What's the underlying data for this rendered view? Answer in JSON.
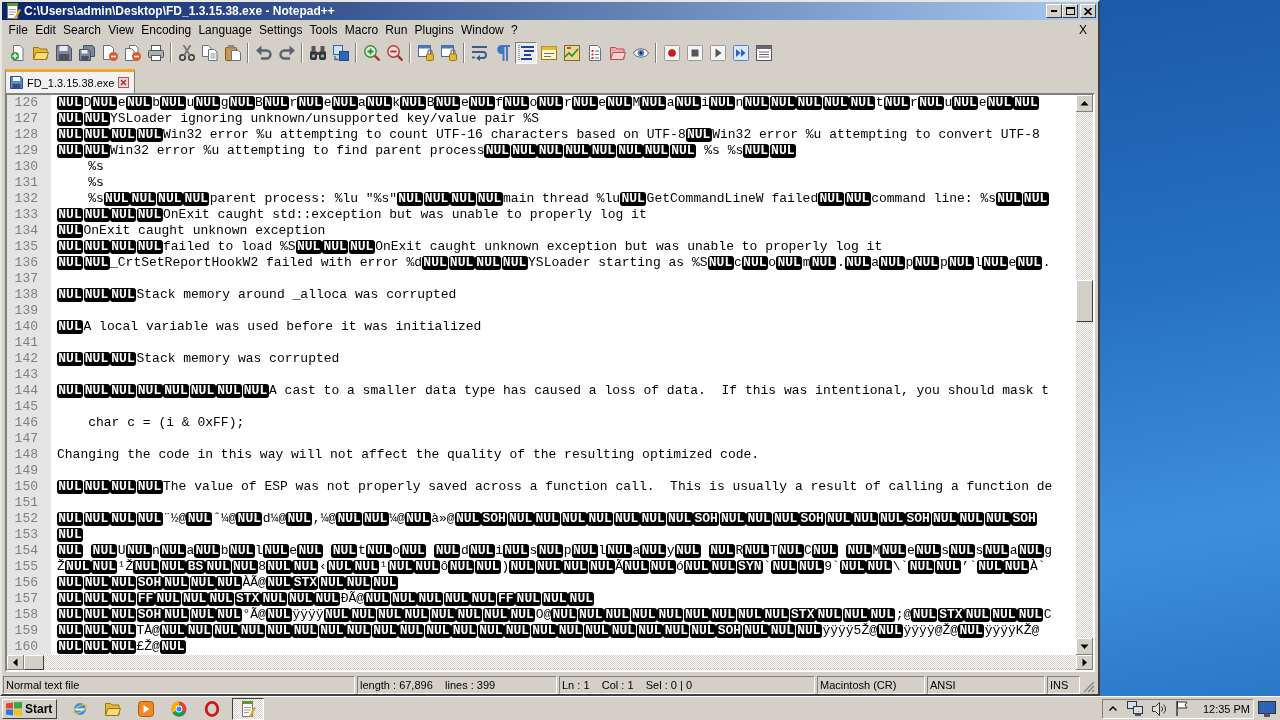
{
  "window": {
    "title": "C:\\Users\\admin\\Desktop\\FD_1.3.15.38.exe - Notepad++"
  },
  "menu": {
    "items": [
      "File",
      "Edit",
      "Search",
      "View",
      "Encoding",
      "Language",
      "Settings",
      "Tools",
      "Macro",
      "Run",
      "Plugins",
      "Window",
      "?"
    ],
    "close": "X"
  },
  "toolbar": [
    [
      {
        "pressed": false
      },
      {
        "pressed": false
      },
      {
        "pressed": false
      },
      {
        "pressed": false
      },
      {
        "pressed": false
      },
      {
        "pressed": false
      },
      {
        "pressed": false
      }
    ],
    [
      {
        "pressed": false
      },
      {
        "pressed": false
      },
      {
        "pressed": false
      }
    ],
    [
      {
        "pressed": false
      },
      {
        "pressed": false
      }
    ],
    [
      {
        "pressed": false
      },
      {
        "pressed": false
      }
    ],
    [
      {
        "pressed": false
      },
      {
        "pressed": false
      }
    ],
    [
      {
        "pressed": false
      },
      {
        "pressed": false
      }
    ],
    [
      {
        "pressed": false
      },
      {
        "pressed": false
      },
      {
        "pressed": true
      },
      {
        "pressed": false
      },
      {
        "pressed": false
      },
      {
        "pressed": false
      },
      {
        "pressed": false
      },
      {
        "pressed": false
      }
    ],
    [
      {
        "pressed": false
      },
      {
        "pressed": false
      },
      {
        "pressed": false
      },
      {
        "pressed": false
      },
      {
        "pressed": false
      }
    ]
  ],
  "tabs": [
    {
      "label": "FD_1.3.15.38.exe",
      "selected": true
    }
  ],
  "editor": {
    "lines": [
      {
        "number": "126",
        "segments": [
          {
            "kind": "ctrl",
            "text": "NUL"
          },
          {
            "kind": "text",
            "text": "D"
          },
          {
            "kind": "ctrl",
            "text": "NUL"
          },
          {
            "kind": "text",
            "text": "e"
          },
          {
            "kind": "ctrl",
            "text": "NUL"
          },
          {
            "kind": "text",
            "text": "b"
          },
          {
            "kind": "ctrl",
            "text": "NUL"
          },
          {
            "kind": "text",
            "text": "u"
          },
          {
            "kind": "ctrl",
            "text": "NUL"
          },
          {
            "kind": "text",
            "text": "g"
          },
          {
            "kind": "ctrl",
            "text": "NUL"
          },
          {
            "kind": "text",
            "text": "B"
          },
          {
            "kind": "ctrl",
            "text": "NUL"
          },
          {
            "kind": "text",
            "text": "r"
          },
          {
            "kind": "ctrl",
            "text": "NUL"
          },
          {
            "kind": "text",
            "text": "e"
          },
          {
            "kind": "ctrl",
            "text": "NUL"
          },
          {
            "kind": "text",
            "text": "a"
          },
          {
            "kind": "ctrl",
            "text": "NUL"
          },
          {
            "kind": "text",
            "text": "k"
          },
          {
            "kind": "ctrl",
            "text": "NUL"
          },
          {
            "kind": "text",
            "text": "B"
          },
          {
            "kind": "ctrl",
            "text": "NUL"
          },
          {
            "kind": "text",
            "text": "e"
          },
          {
            "kind": "ctrl",
            "text": "NUL"
          },
          {
            "kind": "text",
            "text": "f"
          },
          {
            "kind": "ctrl",
            "text": "NUL"
          },
          {
            "kind": "text",
            "text": "o"
          },
          {
            "kind": "ctrl",
            "text": "NUL"
          },
          {
            "kind": "text",
            "text": "r"
          },
          {
            "kind": "ctrl",
            "text": "NUL"
          },
          {
            "kind": "text",
            "text": "e"
          },
          {
            "kind": "ctrl",
            "text": "NUL"
          },
          {
            "kind": "text",
            "text": "M"
          },
          {
            "kind": "ctrl",
            "text": "NUL"
          },
          {
            "kind": "text",
            "text": "a"
          },
          {
            "kind": "ctrl",
            "text": "NUL"
          },
          {
            "kind": "text",
            "text": "i"
          },
          {
            "kind": "ctrl",
            "text": "NUL"
          },
          {
            "kind": "text",
            "text": "n"
          },
          {
            "kind": "ctrl",
            "text": "NUL"
          },
          {
            "kind": "ctrl",
            "text": "NUL"
          },
          {
            "kind": "ctrl",
            "text": "NUL"
          },
          {
            "kind": "ctrl",
            "text": "NUL"
          },
          {
            "kind": "ctrl",
            "text": "NUL"
          },
          {
            "kind": "text",
            "text": "t"
          },
          {
            "kind": "ctrl",
            "text": "NUL"
          },
          {
            "kind": "text",
            "text": "r"
          },
          {
            "kind": "ctrl",
            "text": "NUL"
          },
          {
            "kind": "text",
            "text": "u"
          },
          {
            "kind": "ctrl",
            "text": "NUL"
          },
          {
            "kind": "text",
            "text": "e"
          },
          {
            "kind": "ctrl",
            "text": "NUL"
          },
          {
            "kind": "ctrl",
            "text": "NUL"
          }
        ]
      },
      {
        "number": "127",
        "segments": [
          {
            "kind": "ctrl",
            "text": "NUL"
          },
          {
            "kind": "ctrl",
            "text": "NUL"
          },
          {
            "kind": "text",
            "text": "YSLoader ignoring unknown/unsupported key/value pair %S"
          }
        ]
      },
      {
        "number": "128",
        "segments": [
          {
            "kind": "ctrl",
            "text": "NUL"
          },
          {
            "kind": "ctrl",
            "text": "NUL"
          },
          {
            "kind": "ctrl",
            "text": "NUL"
          },
          {
            "kind": "ctrl",
            "text": "NUL"
          },
          {
            "kind": "text",
            "text": "Win32 error %u attempting to count UTF-16 characters based on UTF-8"
          },
          {
            "kind": "ctrl",
            "text": "NUL"
          },
          {
            "kind": "text",
            "text": "Win32 error %u attempting to convert UTF-8"
          }
        ]
      },
      {
        "number": "129",
        "segments": [
          {
            "kind": "ctrl",
            "text": "NUL"
          },
          {
            "kind": "ctrl",
            "text": "NUL"
          },
          {
            "kind": "text",
            "text": "Win32 error %u attempting to find parent process"
          },
          {
            "kind": "ctrl",
            "text": "NUL"
          },
          {
            "kind": "ctrl",
            "text": "NUL"
          },
          {
            "kind": "ctrl",
            "text": "NUL"
          },
          {
            "kind": "ctrl",
            "text": "NUL"
          },
          {
            "kind": "ctrl",
            "text": "NUL"
          },
          {
            "kind": "ctrl",
            "text": "NUL"
          },
          {
            "kind": "ctrl",
            "text": "NUL"
          },
          {
            "kind": "ctrl",
            "text": "NUL"
          },
          {
            "kind": "space"
          },
          {
            "kind": "text",
            "text": "%s %s"
          },
          {
            "kind": "ctrl",
            "text": "NUL"
          },
          {
            "kind": "ctrl",
            "text": "NUL"
          }
        ]
      },
      {
        "number": "130",
        "segments": [
          {
            "kind": "indent"
          },
          {
            "kind": "text",
            "text": "%s"
          }
        ]
      },
      {
        "number": "131",
        "segments": [
          {
            "kind": "indent"
          },
          {
            "kind": "text",
            "text": "%s"
          }
        ]
      },
      {
        "number": "132",
        "segments": [
          {
            "kind": "indent"
          },
          {
            "kind": "text",
            "text": "%s"
          },
          {
            "kind": "ctrl",
            "text": "NUL"
          },
          {
            "kind": "ctrl",
            "text": "NUL"
          },
          {
            "kind": "ctrl",
            "text": "NUL"
          },
          {
            "kind": "ctrl",
            "text": "NUL"
          },
          {
            "kind": "text",
            "text": "parent process: %lu \"%s\""
          },
          {
            "kind": "ctrl",
            "text": "NUL"
          },
          {
            "kind": "ctrl",
            "text": "NUL"
          },
          {
            "kind": "ctrl",
            "text": "NUL"
          },
          {
            "kind": "ctrl",
            "text": "NUL"
          },
          {
            "kind": "text",
            "text": "main thread %lu"
          },
          {
            "kind": "ctrl",
            "text": "NUL"
          },
          {
            "kind": "text",
            "text": "GetCommandLineW failed"
          },
          {
            "kind": "ctrl",
            "text": "NUL"
          },
          {
            "kind": "ctrl",
            "text": "NUL"
          },
          {
            "kind": "text",
            "text": "command line: %s"
          },
          {
            "kind": "ctrl",
            "text": "NUL"
          },
          {
            "kind": "ctrl",
            "text": "NUL"
          }
        ]
      },
      {
        "number": "133",
        "segments": [
          {
            "kind": "ctrl",
            "text": "NUL"
          },
          {
            "kind": "ctrl",
            "text": "NUL"
          },
          {
            "kind": "ctrl",
            "text": "NUL"
          },
          {
            "kind": "ctrl",
            "text": "NUL"
          },
          {
            "kind": "text",
            "text": "OnExit caught std::exception but was unable to properly log it"
          }
        ]
      },
      {
        "number": "134",
        "segments": [
          {
            "kind": "ctrl",
            "text": "NUL"
          },
          {
            "kind": "text",
            "text": "OnExit caught unknown exception"
          }
        ]
      },
      {
        "number": "135",
        "segments": [
          {
            "kind": "ctrl",
            "text": "NUL"
          },
          {
            "kind": "ctrl",
            "text": "NUL"
          },
          {
            "kind": "ctrl",
            "text": "NUL"
          },
          {
            "kind": "ctrl",
            "text": "NUL"
          },
          {
            "kind": "text",
            "text": "failed to load %S"
          },
          {
            "kind": "ctrl",
            "text": "NUL"
          },
          {
            "kind": "ctrl",
            "text": "NUL"
          },
          {
            "kind": "ctrl",
            "text": "NUL"
          },
          {
            "kind": "text",
            "text": "OnExit caught unknown exception but was unable to properly log it"
          }
        ]
      },
      {
        "number": "136",
        "segments": [
          {
            "kind": "ctrl",
            "text": "NUL"
          },
          {
            "kind": "ctrl",
            "text": "NUL"
          },
          {
            "kind": "text",
            "text": "_CrtSetReportHookW2 failed with error %d"
          },
          {
            "kind": "ctrl",
            "text": "NUL"
          },
          {
            "kind": "ctrl",
            "text": "NUL"
          },
          {
            "kind": "ctrl",
            "text": "NUL"
          },
          {
            "kind": "ctrl",
            "text": "NUL"
          },
          {
            "kind": "text",
            "text": "YSLoader starting as %S"
          },
          {
            "kind": "ctrl",
            "text": "NUL"
          },
          {
            "kind": "text",
            "text": "c"
          },
          {
            "kind": "ctrl",
            "text": "NUL"
          },
          {
            "kind": "text",
            "text": "o"
          },
          {
            "kind": "ctrl",
            "text": "NUL"
          },
          {
            "kind": "text",
            "text": "m"
          },
          {
            "kind": "ctrl",
            "text": "NUL"
          },
          {
            "kind": "text",
            "text": "."
          },
          {
            "kind": "ctrl",
            "text": "NUL"
          },
          {
            "kind": "text",
            "text": "a"
          },
          {
            "kind": "ctrl",
            "text": "NUL"
          },
          {
            "kind": "text",
            "text": "p"
          },
          {
            "kind": "ctrl",
            "text": "NUL"
          },
          {
            "kind": "text",
            "text": "p"
          },
          {
            "kind": "ctrl",
            "text": "NUL"
          },
          {
            "kind": "text",
            "text": "l"
          },
          {
            "kind": "ctrl",
            "text": "NUL"
          },
          {
            "kind": "text",
            "text": "e"
          },
          {
            "kind": "ctrl",
            "text": "NUL"
          },
          {
            "kind": "text",
            "text": "."
          }
        ]
      },
      {
        "number": "137"
      },
      {
        "number": "138",
        "segments": [
          {
            "kind": "ctrl",
            "text": "NUL"
          },
          {
            "kind": "ctrl",
            "text": "NUL"
          },
          {
            "kind": "ctrl",
            "text": "NUL"
          },
          {
            "kind": "text",
            "text": "Stack memory around _alloca was corrupted"
          }
        ]
      },
      {
        "number": "139"
      },
      {
        "number": "140",
        "segments": [
          {
            "kind": "ctrl",
            "text": "NUL"
          },
          {
            "kind": "text",
            "text": "A local variable was used before it was initialized"
          }
        ]
      },
      {
        "number": "141"
      },
      {
        "number": "142",
        "segments": [
          {
            "kind": "ctrl",
            "text": "NUL"
          },
          {
            "kind": "ctrl",
            "text": "NUL"
          },
          {
            "kind": "ctrl",
            "text": "NUL"
          },
          {
            "kind": "text",
            "text": "Stack memory was corrupted"
          }
        ]
      },
      {
        "number": "143"
      },
      {
        "number": "144",
        "segments": [
          {
            "kind": "ctrl",
            "text": "NUL"
          },
          {
            "kind": "ctrl",
            "text": "NUL"
          },
          {
            "kind": "ctrl",
            "text": "NUL"
          },
          {
            "kind": "ctrl",
            "text": "NUL"
          },
          {
            "kind": "ctrl",
            "text": "NUL"
          },
          {
            "kind": "ctrl",
            "text": "NUL"
          },
          {
            "kind": "ctrl",
            "text": "NUL"
          },
          {
            "kind": "ctrl",
            "text": "NUL"
          },
          {
            "kind": "text",
            "text": "A cast to a smaller data type has caused a loss of data.  If this was intentional, you should mask t"
          }
        ]
      },
      {
        "number": "145"
      },
      {
        "number": "146",
        "segments": [
          {
            "kind": "indent"
          },
          {
            "kind": "text",
            "text": "char c = (i & 0xFF);"
          }
        ]
      },
      {
        "number": "147"
      },
      {
        "number": "148",
        "segments": [
          {
            "kind": "text",
            "text": "Changing the code in this way will not affect the quality of the resulting optimized code."
          }
        ]
      },
      {
        "number": "149"
      },
      {
        "number": "150",
        "segments": [
          {
            "kind": "ctrl",
            "text": "NUL"
          },
          {
            "kind": "ctrl",
            "text": "NUL"
          },
          {
            "kind": "ctrl",
            "text": "NUL"
          },
          {
            "kind": "ctrl",
            "text": "NUL"
          },
          {
            "kind": "text",
            "text": "The value of ESP was not properly saved across a function call.  This is usually a result of calling a function de"
          }
        ]
      },
      {
        "number": "151"
      },
      {
        "number": "152",
        "segments": [
          {
            "kind": "ctrl",
            "text": "NUL"
          },
          {
            "kind": "ctrl",
            "text": "NUL"
          },
          {
            "kind": "ctrl",
            "text": "NUL"
          },
          {
            "kind": "ctrl",
            "text": "NUL"
          },
          {
            "kind": "text",
            "text": "¨½@"
          },
          {
            "kind": "ctrl",
            "text": "NUL"
          },
          {
            "kind": "text",
            "text": "ˆ¼@"
          },
          {
            "kind": "ctrl",
            "text": "NUL"
          },
          {
            "kind": "text",
            "text": "d¼@"
          },
          {
            "kind": "ctrl",
            "text": "NUL"
          },
          {
            "kind": "text",
            "text": ",¼@"
          },
          {
            "kind": "ctrl",
            "text": "NUL"
          },
          {
            "kind": "ctrl",
            "text": "NUL"
          },
          {
            "kind": "text",
            "text": "¼@"
          },
          {
            "kind": "ctrl",
            "text": "NUL"
          },
          {
            "kind": "text",
            "text": "à»@"
          },
          {
            "kind": "ctrl",
            "text": "NUL"
          },
          {
            "kind": "ctrl",
            "text": "SOH"
          },
          {
            "kind": "ctrl",
            "text": "NUL"
          },
          {
            "kind": "ctrl",
            "text": "NUL"
          },
          {
            "kind": "ctrl",
            "text": "NUL"
          },
          {
            "kind": "ctrl",
            "text": "NUL"
          },
          {
            "kind": "ctrl",
            "text": "NUL"
          },
          {
            "kind": "ctrl",
            "text": "NUL"
          },
          {
            "kind": "ctrl",
            "text": "NUL"
          },
          {
            "kind": "ctrl",
            "text": "SOH"
          },
          {
            "kind": "ctrl",
            "text": "NUL"
          },
          {
            "kind": "ctrl",
            "text": "NUL"
          },
          {
            "kind": "ctrl",
            "text": "NUL"
          },
          {
            "kind": "ctrl",
            "text": "SOH"
          },
          {
            "kind": "ctrl",
            "text": "NUL"
          },
          {
            "kind": "ctrl",
            "text": "NUL"
          },
          {
            "kind": "ctrl",
            "text": "NUL"
          },
          {
            "kind": "ctrl",
            "text": "SOH"
          },
          {
            "kind": "ctrl",
            "text": "NUL"
          },
          {
            "kind": "ctrl",
            "text": "NUL"
          },
          {
            "kind": "ctrl",
            "text": "NUL"
          },
          {
            "kind": "ctrl",
            "text": "SOH"
          }
        ]
      },
      {
        "number": "153",
        "segments": [
          {
            "kind": "ctrl",
            "text": "NUL"
          }
        ]
      },
      {
        "number": "154",
        "segments": [
          {
            "kind": "ctrl",
            "text": "NUL"
          },
          {
            "kind": "space"
          },
          {
            "kind": "ctrl",
            "text": "NUL"
          },
          {
            "kind": "text",
            "text": "U"
          },
          {
            "kind": "ctrl",
            "text": "NUL"
          },
          {
            "kind": "text",
            "text": "n"
          },
          {
            "kind": "ctrl",
            "text": "NUL"
          },
          {
            "kind": "text",
            "text": "a"
          },
          {
            "kind": "ctrl",
            "text": "NUL"
          },
          {
            "kind": "text",
            "text": "b"
          },
          {
            "kind": "ctrl",
            "text": "NUL"
          },
          {
            "kind": "text",
            "text": "l"
          },
          {
            "kind": "ctrl",
            "text": "NUL"
          },
          {
            "kind": "text",
            "text": "e"
          },
          {
            "kind": "ctrl",
            "text": "NUL"
          },
          {
            "kind": "space"
          },
          {
            "kind": "ctrl",
            "text": "NUL"
          },
          {
            "kind": "text",
            "text": "t"
          },
          {
            "kind": "ctrl",
            "text": "NUL"
          },
          {
            "kind": "text",
            "text": "o"
          },
          {
            "kind": "ctrl",
            "text": "NUL"
          },
          {
            "kind": "space"
          },
          {
            "kind": "ctrl",
            "text": "NUL"
          },
          {
            "kind": "text",
            "text": "d"
          },
          {
            "kind": "ctrl",
            "text": "NUL"
          },
          {
            "kind": "text",
            "text": "i"
          },
          {
            "kind": "ctrl",
            "text": "NUL"
          },
          {
            "kind": "text",
            "text": "s"
          },
          {
            "kind": "ctrl",
            "text": "NUL"
          },
          {
            "kind": "text",
            "text": "p"
          },
          {
            "kind": "ctrl",
            "text": "NUL"
          },
          {
            "kind": "text",
            "text": "l"
          },
          {
            "kind": "ctrl",
            "text": "NUL"
          },
          {
            "kind": "text",
            "text": "a"
          },
          {
            "kind": "ctrl",
            "text": "NUL"
          },
          {
            "kind": "text",
            "text": "y"
          },
          {
            "kind": "ctrl",
            "text": "NUL"
          },
          {
            "kind": "space"
          },
          {
            "kind": "ctrl",
            "text": "NUL"
          },
          {
            "kind": "text",
            "text": "R"
          },
          {
            "kind": "ctrl",
            "text": "NUL"
          },
          {
            "kind": "text",
            "text": "T"
          },
          {
            "kind": "ctrl",
            "text": "NUL"
          },
          {
            "kind": "text",
            "text": "C"
          },
          {
            "kind": "ctrl",
            "text": "NUL"
          },
          {
            "kind": "space"
          },
          {
            "kind": "ctrl",
            "text": "NUL"
          },
          {
            "kind": "text",
            "text": "M"
          },
          {
            "kind": "ctrl",
            "text": "NUL"
          },
          {
            "kind": "text",
            "text": "e"
          },
          {
            "kind": "ctrl",
            "text": "NUL"
          },
          {
            "kind": "text",
            "text": "s"
          },
          {
            "kind": "ctrl",
            "text": "NUL"
          },
          {
            "kind": "text",
            "text": "s"
          },
          {
            "kind": "ctrl",
            "text": "NUL"
          },
          {
            "kind": "text",
            "text": "a"
          },
          {
            "kind": "ctrl",
            "text": "NUL"
          },
          {
            "kind": "text",
            "text": "g"
          }
        ]
      },
      {
        "number": "155",
        "segments": [
          {
            "kind": "text",
            "text": "Ž"
          },
          {
            "kind": "ctrl",
            "text": "NUL"
          },
          {
            "kind": "ctrl",
            "text": "NUL"
          },
          {
            "kind": "text",
            "text": "¹Ž"
          },
          {
            "kind": "ctrl",
            "text": "NUL"
          },
          {
            "kind": "ctrl",
            "text": "NUL"
          },
          {
            "kind": "ctrl",
            "text": "BS"
          },
          {
            "kind": "ctrl",
            "text": "NUL"
          },
          {
            "kind": "ctrl",
            "text": "NUL"
          },
          {
            "kind": "text",
            "text": "8"
          },
          {
            "kind": "ctrl",
            "text": "NUL"
          },
          {
            "kind": "ctrl",
            "text": "NUL"
          },
          {
            "kind": "text",
            "text": "‹"
          },
          {
            "kind": "ctrl",
            "text": "NUL"
          },
          {
            "kind": "ctrl",
            "text": "NUL"
          },
          {
            "kind": "text",
            "text": "¹"
          },
          {
            "kind": "ctrl",
            "text": "NUL"
          },
          {
            "kind": "ctrl",
            "text": "NUL"
          },
          {
            "kind": "text",
            "text": "ô"
          },
          {
            "kind": "ctrl",
            "text": "NUL"
          },
          {
            "kind": "ctrl",
            "text": "NUL"
          },
          {
            "kind": "text",
            "text": ")"
          },
          {
            "kind": "ctrl",
            "text": "NUL"
          },
          {
            "kind": "ctrl",
            "text": "NUL"
          },
          {
            "kind": "ctrl",
            "text": "NUL"
          },
          {
            "kind": "ctrl",
            "text": "NUL"
          },
          {
            "kind": "text",
            "text": "Ã"
          },
          {
            "kind": "ctrl",
            "text": "NUL"
          },
          {
            "kind": "ctrl",
            "text": "NUL"
          },
          {
            "kind": "text",
            "text": "ó"
          },
          {
            "kind": "ctrl",
            "text": "NUL"
          },
          {
            "kind": "ctrl",
            "text": "NUL"
          },
          {
            "kind": "ctrl",
            "text": "SYN"
          },
          {
            "kind": "text",
            "text": "`"
          },
          {
            "kind": "ctrl",
            "text": "NUL"
          },
          {
            "kind": "ctrl",
            "text": "NUL"
          },
          {
            "kind": "text",
            "text": "9`"
          },
          {
            "kind": "ctrl",
            "text": "NUL"
          },
          {
            "kind": "ctrl",
            "text": "NUL"
          },
          {
            "kind": "text",
            "text": "\\`"
          },
          {
            "kind": "ctrl",
            "text": "NUL"
          },
          {
            "kind": "ctrl",
            "text": "NUL"
          },
          {
            "kind": "text",
            "text": "’`"
          },
          {
            "kind": "ctrl",
            "text": "NUL"
          },
          {
            "kind": "ctrl",
            "text": "NUL"
          },
          {
            "kind": "text",
            "text": "À`"
          }
        ]
      },
      {
        "number": "156",
        "segments": [
          {
            "kind": "ctrl",
            "text": "NUL"
          },
          {
            "kind": "ctrl",
            "text": "NUL"
          },
          {
            "kind": "ctrl",
            "text": "NUL"
          },
          {
            "kind": "ctrl",
            "text": "SOH"
          },
          {
            "kind": "ctrl",
            "text": "NUL"
          },
          {
            "kind": "ctrl",
            "text": "NUL"
          },
          {
            "kind": "ctrl",
            "text": "NUL"
          },
          {
            "kind": "text",
            "text": "ÀÃ@"
          },
          {
            "kind": "ctrl",
            "text": "NUL"
          },
          {
            "kind": "ctrl",
            "text": "STX"
          },
          {
            "kind": "ctrl",
            "text": "NUL"
          },
          {
            "kind": "ctrl",
            "text": "NUL"
          },
          {
            "kind": "ctrl",
            "text": "NUL"
          }
        ]
      },
      {
        "number": "157",
        "segments": [
          {
            "kind": "ctrl",
            "text": "NUL"
          },
          {
            "kind": "ctrl",
            "text": "NUL"
          },
          {
            "kind": "ctrl",
            "text": "NUL"
          },
          {
            "kind": "ctrl",
            "text": "FF"
          },
          {
            "kind": "ctrl",
            "text": "NUL"
          },
          {
            "kind": "ctrl",
            "text": "NUL"
          },
          {
            "kind": "ctrl",
            "text": "NUL"
          },
          {
            "kind": "ctrl",
            "text": "STX"
          },
          {
            "kind": "ctrl",
            "text": "NUL"
          },
          {
            "kind": "ctrl",
            "text": "NUL"
          },
          {
            "kind": "ctrl",
            "text": "NUL"
          },
          {
            "kind": "text",
            "text": "ÐÃ@"
          },
          {
            "kind": "ctrl",
            "text": "NUL"
          },
          {
            "kind": "ctrl",
            "text": "NUL"
          },
          {
            "kind": "ctrl",
            "text": "NUL"
          },
          {
            "kind": "ctrl",
            "text": "NUL"
          },
          {
            "kind": "ctrl",
            "text": "NUL"
          },
          {
            "kind": "ctrl",
            "text": "FF"
          },
          {
            "kind": "ctrl",
            "text": "NUL"
          },
          {
            "kind": "ctrl",
            "text": "NUL"
          },
          {
            "kind": "ctrl",
            "text": "NUL"
          }
        ]
      },
      {
        "number": "158",
        "segments": [
          {
            "kind": "ctrl",
            "text": "NUL"
          },
          {
            "kind": "ctrl",
            "text": "NUL"
          },
          {
            "kind": "ctrl",
            "text": "NUL"
          },
          {
            "kind": "ctrl",
            "text": "SOH"
          },
          {
            "kind": "ctrl",
            "text": "NUL"
          },
          {
            "kind": "ctrl",
            "text": "NUL"
          },
          {
            "kind": "ctrl",
            "text": "NUL"
          },
          {
            "kind": "text",
            "text": "°Ã@"
          },
          {
            "kind": "ctrl",
            "text": "NUL"
          },
          {
            "kind": "text",
            "text": "ÿÿÿÿ"
          },
          {
            "kind": "ctrl",
            "text": "NUL"
          },
          {
            "kind": "ctrl",
            "text": "NUL"
          },
          {
            "kind": "ctrl",
            "text": "NUL"
          },
          {
            "kind": "ctrl",
            "text": "NUL"
          },
          {
            "kind": "ctrl",
            "text": "NUL"
          },
          {
            "kind": "ctrl",
            "text": "NUL"
          },
          {
            "kind": "ctrl",
            "text": "NUL"
          },
          {
            "kind": "ctrl",
            "text": "NUL"
          },
          {
            "kind": "text",
            "text": "O@"
          },
          {
            "kind": "ctrl",
            "text": "NUL"
          },
          {
            "kind": "ctrl",
            "text": "NUL"
          },
          {
            "kind": "ctrl",
            "text": "NUL"
          },
          {
            "kind": "ctrl",
            "text": "NUL"
          },
          {
            "kind": "ctrl",
            "text": "NUL"
          },
          {
            "kind": "ctrl",
            "text": "NUL"
          },
          {
            "kind": "ctrl",
            "text": "NUL"
          },
          {
            "kind": "ctrl",
            "text": "NUL"
          },
          {
            "kind": "ctrl",
            "text": "NUL"
          },
          {
            "kind": "ctrl",
            "text": "STX"
          },
          {
            "kind": "ctrl",
            "text": "NUL"
          },
          {
            "kind": "ctrl",
            "text": "NUL"
          },
          {
            "kind": "ctrl",
            "text": "NUL"
          },
          {
            "kind": "text",
            "text": ";@"
          },
          {
            "kind": "ctrl",
            "text": "NUL"
          },
          {
            "kind": "ctrl",
            "text": "STX"
          },
          {
            "kind": "ctrl",
            "text": "NUL"
          },
          {
            "kind": "ctrl",
            "text": "NUL"
          },
          {
            "kind": "ctrl",
            "text": "NUL"
          },
          {
            "kind": "text",
            "text": "C"
          }
        ]
      },
      {
        "number": "159",
        "segments": [
          {
            "kind": "ctrl",
            "text": "NUL"
          },
          {
            "kind": "ctrl",
            "text": "NUL"
          },
          {
            "kind": "ctrl",
            "text": "NUL"
          },
          {
            "kind": "text",
            "text": "TÅ@"
          },
          {
            "kind": "ctrl",
            "text": "NUL"
          },
          {
            "kind": "ctrl",
            "text": "NUL"
          },
          {
            "kind": "ctrl",
            "text": "NUL"
          },
          {
            "kind": "ctrl",
            "text": "NUL"
          },
          {
            "kind": "ctrl",
            "text": "NUL"
          },
          {
            "kind": "ctrl",
            "text": "NUL"
          },
          {
            "kind": "ctrl",
            "text": "NUL"
          },
          {
            "kind": "ctrl",
            "text": "NUL"
          },
          {
            "kind": "ctrl",
            "text": "NUL"
          },
          {
            "kind": "ctrl",
            "text": "NUL"
          },
          {
            "kind": "ctrl",
            "text": "NUL"
          },
          {
            "kind": "ctrl",
            "text": "NUL"
          },
          {
            "kind": "ctrl",
            "text": "NUL"
          },
          {
            "kind": "ctrl",
            "text": "NUL"
          },
          {
            "kind": "ctrl",
            "text": "NUL"
          },
          {
            "kind": "ctrl",
            "text": "NUL"
          },
          {
            "kind": "ctrl",
            "text": "NUL"
          },
          {
            "kind": "ctrl",
            "text": "NUL"
          },
          {
            "kind": "ctrl",
            "text": "NUL"
          },
          {
            "kind": "ctrl",
            "text": "NUL"
          },
          {
            "kind": "ctrl",
            "text": "NUL"
          },
          {
            "kind": "ctrl",
            "text": "SOH"
          },
          {
            "kind": "ctrl",
            "text": "NUL"
          },
          {
            "kind": "ctrl",
            "text": "NUL"
          },
          {
            "kind": "ctrl",
            "text": "NUL"
          },
          {
            "kind": "text",
            "text": "ÿÿÿÿ5Ž@"
          },
          {
            "kind": "ctrl",
            "text": "NUL"
          },
          {
            "kind": "text",
            "text": "ÿÿÿÿ@Ž@"
          },
          {
            "kind": "ctrl",
            "text": "NUL"
          },
          {
            "kind": "text",
            "text": "ÿÿÿÿKŽ@"
          }
        ]
      },
      {
        "number": "160",
        "segments": [
          {
            "kind": "ctrl",
            "text": "NUL"
          },
          {
            "kind": "ctrl",
            "text": "NUL"
          },
          {
            "kind": "ctrl",
            "text": "NUL"
          },
          {
            "kind": "text",
            "text": "£Ž@"
          },
          {
            "kind": "ctrl",
            "text": "NUL"
          }
        ]
      }
    ]
  },
  "status_bar": [
    "Normal text file",
    "length : 67,896    lines : 399",
    "Ln : 1    Col : 1    Sel : 0 | 0",
    "Macintosh (CR)",
    "ANSI",
    "INS"
  ],
  "taskbar": {
    "start": "Start",
    "tasks": [
      {
        "selected": true
      }
    ],
    "clock": "12:35 PM"
  }
}
